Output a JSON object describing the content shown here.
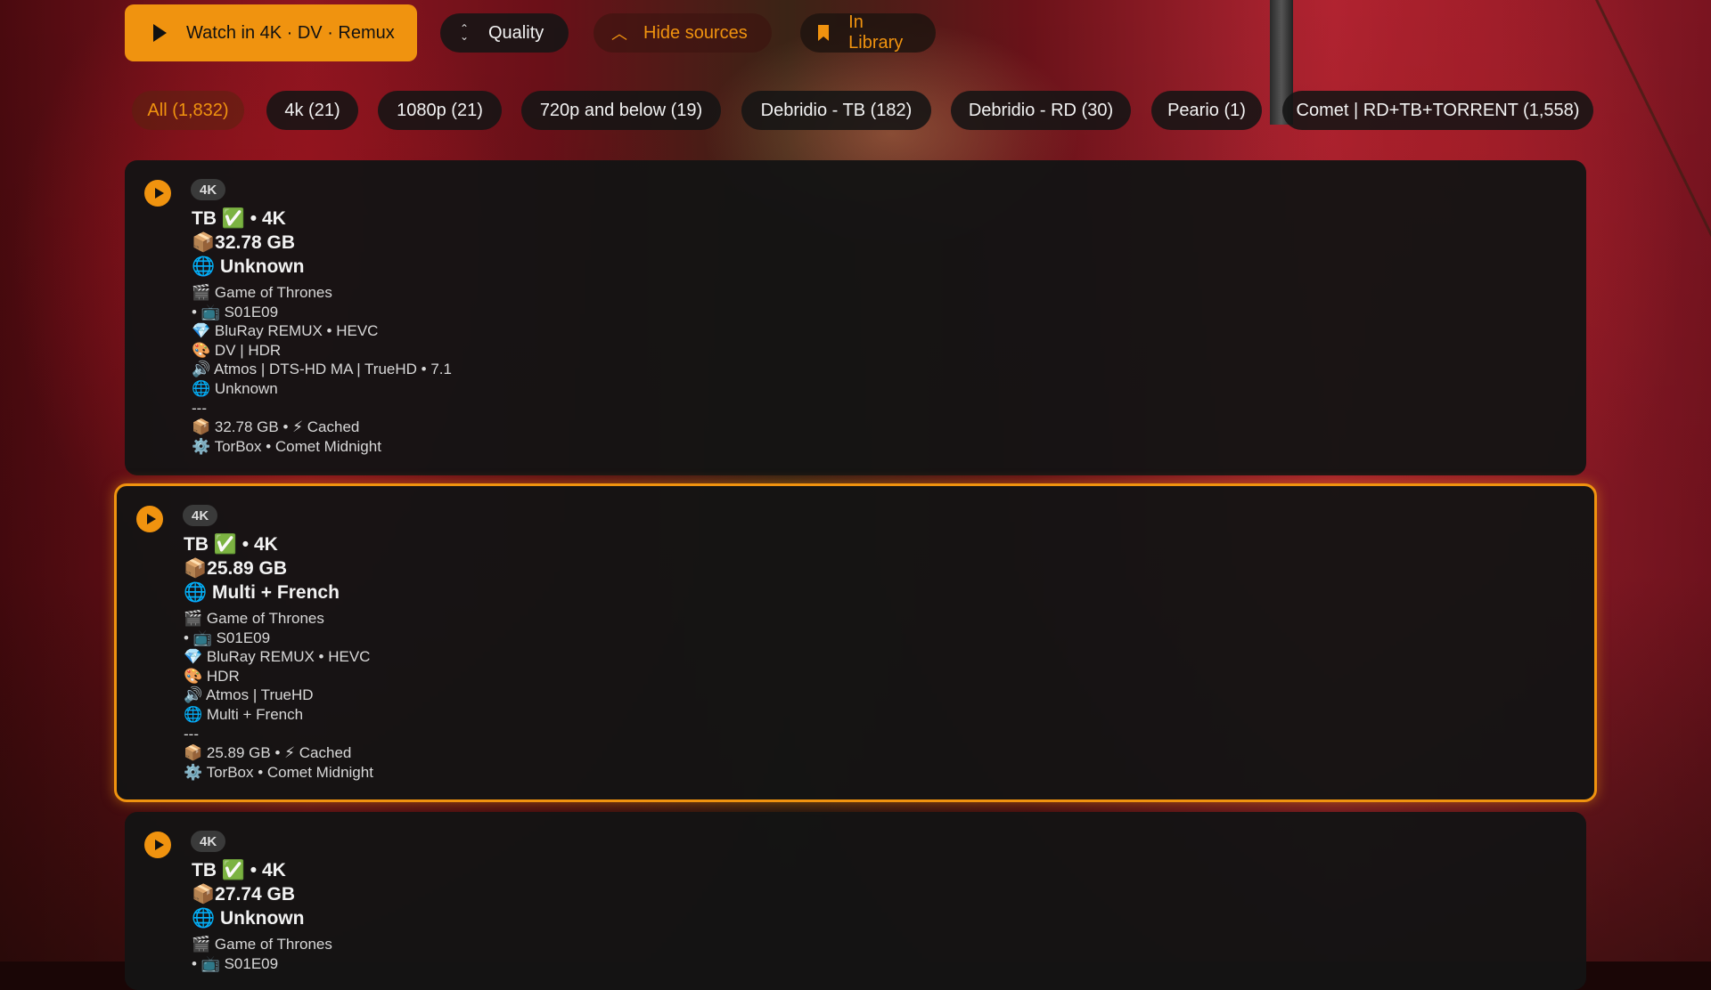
{
  "top_bar": {
    "watch_label": "Watch in 4K · DV · Remux",
    "quality_label": "Quality",
    "hide_sources_label": "Hide sources",
    "library_label": "In Library"
  },
  "filters": [
    {
      "label": "All (1,832)",
      "active": true
    },
    {
      "label": "4k (21)",
      "active": false
    },
    {
      "label": "1080p (21)",
      "active": false
    },
    {
      "label": "720p and below (19)",
      "active": false
    },
    {
      "label": "Debridio - TB (182)",
      "active": false
    },
    {
      "label": "Debridio - RD (30)",
      "active": false
    },
    {
      "label": "Peario (1)",
      "active": false
    },
    {
      "label": "Comet | RD+TB+TORRENT (1,558)",
      "active": false
    }
  ],
  "sources": [
    {
      "badge": "4K",
      "headline": [
        "TB ✅ • 4K",
        "📦32.78 GB",
        "🌐 Unknown"
      ],
      "details": [
        "🎬 Game of Thrones",
        " • 📺 S01E09",
        "💎 BluRay REMUX • HEVC",
        "🎨 DV | HDR",
        "🔊 Atmos | DTS-HD MA | TrueHD • 7.1",
        "🌐 Unknown",
        "---",
        "📦 32.78 GB • ⚡ Cached",
        "⚙️ TorBox • Comet Midnight"
      ],
      "selected": false
    },
    {
      "badge": "4K",
      "headline": [
        "TB ✅ • 4K",
        "📦25.89 GB",
        "🌐 Multi + French"
      ],
      "details": [
        "🎬 Game of Thrones",
        " • 📺 S01E09",
        "💎 BluRay REMUX • HEVC",
        "🎨 HDR",
        "🔊 Atmos | TrueHD",
        "🌐 Multi + French",
        "---",
        "📦 25.89 GB • ⚡ Cached",
        "⚙️ TorBox • Comet Midnight"
      ],
      "selected": true
    },
    {
      "badge": "4K",
      "headline": [
        "TB ✅ • 4K",
        "📦27.74 GB",
        "🌐 Unknown"
      ],
      "details": [
        "🎬 Game of Thrones",
        " • 📺 S01E09"
      ],
      "selected": false
    }
  ]
}
